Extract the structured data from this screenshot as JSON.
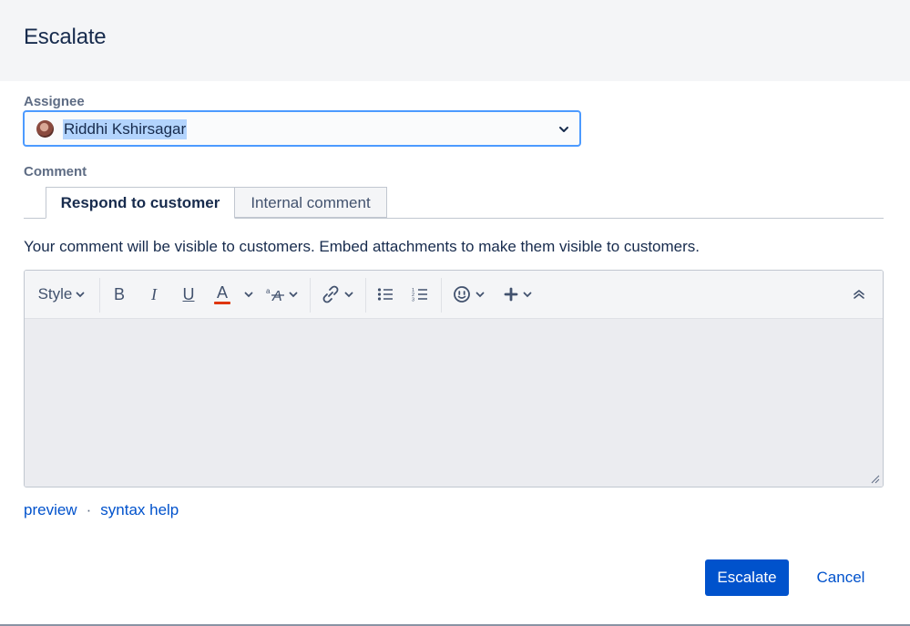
{
  "dialog": {
    "title": "Escalate"
  },
  "assignee": {
    "label": "Assignee",
    "selected_value": "Riddhi Kshirsagar",
    "avatar_icon": "user-avatar",
    "accent_color": "#4c9aff"
  },
  "comment": {
    "label": "Comment",
    "tabs": [
      {
        "label": "Respond to customer",
        "active": true
      },
      {
        "label": "Internal comment",
        "active": false
      }
    ],
    "info_text": "Your comment will be visible to customers. Embed attachments to make them visible to customers."
  },
  "editor": {
    "toolbar": {
      "style_label": "Style",
      "icons": [
        "bold-icon",
        "italic-icon",
        "underline-icon",
        "text-color-icon",
        "text-format-icon",
        "link-icon",
        "bullet-list-icon",
        "numbered-list-icon",
        "emoji-icon",
        "insert-icon",
        "collapse-toolbar-icon"
      ],
      "bold_glyph": "B",
      "italic_glyph": "I",
      "underline_glyph": "U",
      "color_glyph": "A",
      "text_color": "#de350b"
    }
  },
  "footer_links": {
    "preview": "preview",
    "separator": "·",
    "syntax_help": "syntax help"
  },
  "actions": {
    "primary_label": "Escalate",
    "cancel_label": "Cancel",
    "primary_color": "#0052cc"
  }
}
